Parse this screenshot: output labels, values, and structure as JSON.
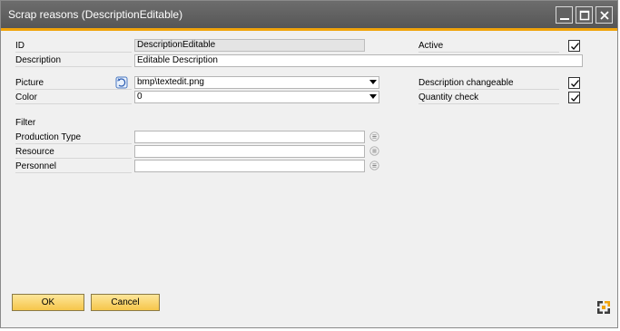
{
  "window": {
    "title": "Scrap reasons (DescriptionEditable)",
    "accent_color": "#f0a30a"
  },
  "form": {
    "id_label": "ID",
    "id_value": "DescriptionEditable",
    "description_label": "Description",
    "description_value": "Editable Description",
    "picture_label": "Picture",
    "picture_value": "bmp\\textedit.png",
    "color_label": "Color",
    "color_value": "0",
    "active_label": "Active",
    "active_checked": true,
    "description_changeable_label": "Description changeable",
    "description_changeable_checked": true,
    "quantity_check_label": "Quantity check",
    "quantity_check_checked": true
  },
  "filter": {
    "heading": "Filter",
    "production_type_label": "Production Type",
    "production_type_value": "",
    "resource_label": "Resource",
    "resource_value": "",
    "personnel_label": "Personnel",
    "personnel_value": ""
  },
  "buttons": {
    "ok_label": "OK",
    "cancel_label": "Cancel"
  },
  "icons": {
    "picture": "picture-browse-icon",
    "picker": "list-picker-icon",
    "logo": "app-logo-icon",
    "minimize": "minimize-icon",
    "maximize": "maximize-icon",
    "close": "close-icon",
    "checkmark": "checkmark-icon"
  }
}
